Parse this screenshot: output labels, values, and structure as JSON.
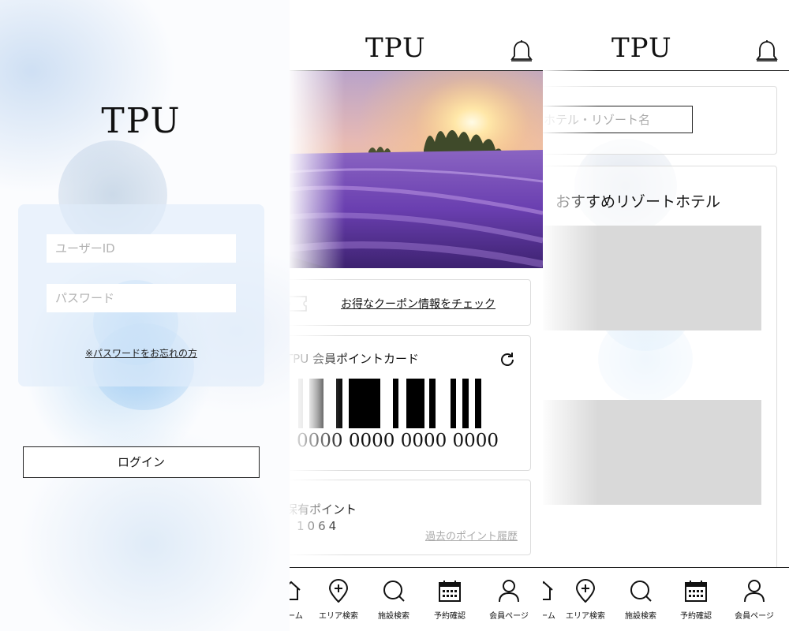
{
  "login": {
    "title": "TPU",
    "user_placeholder": "ユーザーID",
    "password_placeholder": "パスワード",
    "forgot_label": "※パスワードをお忘れの方",
    "login_label": "ログイン"
  },
  "home": {
    "title": "TPU",
    "coupon_label": "お得なクーポン情報をチェック",
    "point_card_title": "TPU 会員ポイントカード",
    "barcode_number": "0000 0000 0000 0000",
    "points_label": "保有ポイント",
    "points_value": "1064",
    "points_history_label": "過去のポイント履歴"
  },
  "search": {
    "title": "TPU",
    "search_placeholder": "ホテル・リゾート名",
    "recommend_title": "おすすめリゾートホテル"
  },
  "nav": {
    "items": [
      {
        "label": "ホーム",
        "icon": "home-icon"
      },
      {
        "label": "エリア検索",
        "icon": "map-pin-plus-icon"
      },
      {
        "label": "施設検索",
        "icon": "search-icon"
      },
      {
        "label": "予約確認",
        "icon": "calendar-icon"
      },
      {
        "label": "会員ページ",
        "icon": "user-icon"
      }
    ]
  }
}
